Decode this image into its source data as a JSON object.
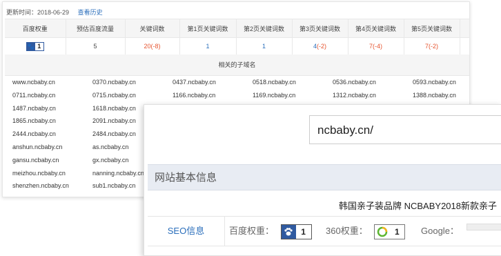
{
  "update": {
    "label": "更新时间：2018-06-29",
    "history_link": "查看历史"
  },
  "stats": {
    "headers": [
      "百度权重",
      "预估百度流量",
      "关键词数",
      "第1页关键词数",
      "第2页关键词数",
      "第3页关键词数",
      "第4页关键词数",
      "第5页关键词数"
    ],
    "baidu_weight": "1",
    "traffic": "5",
    "keywords": "20",
    "keywords_change": "(-8)",
    "p1": "1",
    "p2": "1",
    "p3": "4",
    "p3_change": "(-2)",
    "p4": "7",
    "p4_change": "(-4)",
    "p5": "7",
    "p5_change": "(-2)"
  },
  "subdomains_title": "相关的子域名",
  "subdomains": [
    [
      "www.ncbaby.cn",
      "0370.ncbaby.cn",
      "0437.ncbaby.cn",
      "0518.ncbaby.cn",
      "0536.ncbaby.cn",
      "0593.ncbaby.cn"
    ],
    [
      "0711.ncbaby.cn",
      "0715.ncbaby.cn",
      "1166.ncbaby.cn",
      "1169.ncbaby.cn",
      "1312.ncbaby.cn",
      "1388.ncbaby.cn"
    ],
    [
      "1487.ncbaby.cn",
      "1618.ncbaby.cn"
    ],
    [
      "1865.ncbaby.cn",
      "2091.ncbaby.cn"
    ],
    [
      "2444.ncbaby.cn",
      "2484.ncbaby.cn"
    ],
    [
      "anshun.ncbaby.cn",
      "as.ncbaby.cn"
    ],
    [
      "gansu.ncbaby.cn",
      "gx.ncbaby.cn"
    ],
    [
      "meizhou.ncbaby.cn",
      "nanning.ncbaby.cn"
    ],
    [
      "shenzhen.ncbaby.cn",
      "sub1.ncbaby.cn"
    ]
  ],
  "front": {
    "search_value": "ncbaby.cn/",
    "info_title": "网站基本信息",
    "brand_text": "韩国亲子装品牌 NCBABY2018新款亲子",
    "seo_label": "SEO信息",
    "baidu_label": "百度权重：",
    "baidu_value": "1",
    "w360_label": "360权重：",
    "w360_value": "1",
    "google_label": "Google："
  },
  "colors": {
    "link": "#2a6ebb",
    "decrease": "#e6532e",
    "badge_blue": "#2f5aa0",
    "header_bg": "#e8ecf3"
  }
}
